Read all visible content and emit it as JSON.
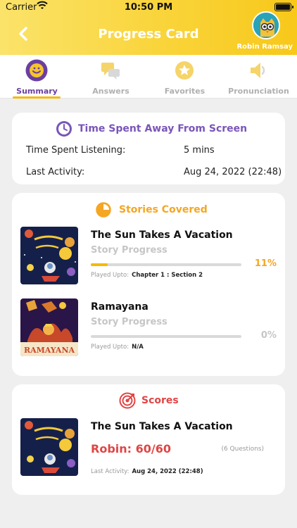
{
  "status_bar": {
    "carrier": "Carrier",
    "time": "10:50 PM"
  },
  "header": {
    "title": "Progress Card",
    "user_name": "Robin Ramsay"
  },
  "tabs": [
    {
      "label": "Summary",
      "icon": "smiley-badge-icon",
      "active": true
    },
    {
      "label": "Answers",
      "icon": "chat-bubbles-icon",
      "active": false
    },
    {
      "label": "Favorites",
      "icon": "star-icon",
      "active": false
    },
    {
      "label": "Pronunciation",
      "icon": "speaker-icon",
      "active": false
    }
  ],
  "time_card": {
    "title": "Time Spent Away From Screen",
    "rows": [
      {
        "label": "Time Spent Listening:",
        "value": "5 mins"
      },
      {
        "label": "Last Activity:",
        "value": "Aug 24, 2022 (22:48)"
      }
    ]
  },
  "stories_card": {
    "title": "Stories Covered",
    "stories": [
      {
        "title": "The Sun Takes A Vacation",
        "subtitle": "Story Progress",
        "progress": 0.11,
        "percent": "11%",
        "played_label": "Played Upto:",
        "played_value": "Chapter 1 : Section 2",
        "thumb_banner": ""
      },
      {
        "title": "Ramayana",
        "subtitle": "Story Progress",
        "progress": 0,
        "percent": "0%",
        "played_label": "Played Upto:",
        "played_value": "N/A",
        "thumb_banner": "RAMAYANA"
      }
    ]
  },
  "scores_card": {
    "title": "Scores",
    "story_title": "The Sun Takes A Vacation",
    "score": "Robin: 60/60",
    "questions": "(6 Questions)",
    "last_label": "Last Activity:",
    "last_value": "Aug 24, 2022 (22:48)"
  },
  "colors": {
    "accent_yellow": "#f5b90a",
    "purple": "#7a55b8",
    "orange": "#f5a623",
    "red": "#e04545"
  }
}
